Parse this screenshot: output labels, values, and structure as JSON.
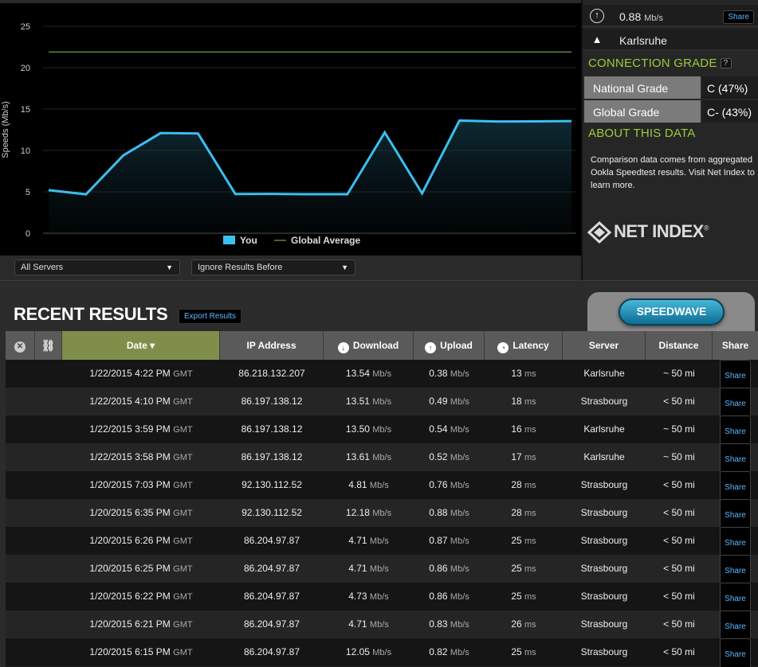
{
  "chart_data": {
    "type": "line",
    "ylabel": "Speeds (Mb/s)",
    "ylim": [
      0,
      25
    ],
    "yticks": [
      "0",
      "5",
      "10",
      "15",
      "20",
      "25"
    ],
    "series": [
      {
        "name": "You",
        "color": "#3bbfef",
        "values": [
          5.2,
          4.7,
          9.4,
          12.1,
          12.05,
          4.73,
          4.75,
          4.71,
          4.71,
          12.18,
          4.81,
          13.61,
          13.5,
          13.51,
          13.54
        ]
      },
      {
        "name": "Global Average",
        "color": "#8ec63f",
        "values": [
          21.9,
          21.9
        ]
      }
    ],
    "grid": true,
    "legend": "bottom-center"
  },
  "filters": {
    "servers": "All Servers",
    "ignore": "Ignore Results Before"
  },
  "side": {
    "upload_value": "0.88",
    "upload_unit": "Mb/s",
    "share": "Share",
    "server": "Karlsruhe",
    "grade_title": "CONNECTION GRADE",
    "help": "?",
    "grades": [
      {
        "label": "National Grade",
        "value": "C (47%)"
      },
      {
        "label": "Global Grade",
        "value": "C- (43%)"
      }
    ],
    "about_title": "ABOUT THIS DATA",
    "about_text": "Comparison data comes from aggregated Ookla Speedtest results. Visit Net Index to learn more.",
    "logo": "NET INDEX",
    "logo_mark": "®"
  },
  "results": {
    "title": "RECENT RESULTS",
    "export": "Export Results",
    "speedwave": "SPEEDWAVE",
    "columns": {
      "date": "Date ▾",
      "ip": "IP Address",
      "download": "Download",
      "upload": "Upload",
      "latency": "Latency",
      "server": "Server",
      "distance": "Distance",
      "share": "Share"
    },
    "rows": [
      {
        "date": "1/22/2015 4:22 PM",
        "tz": "GMT",
        "ip": "86.218.132.207",
        "down": "13.54",
        "up": "0.38",
        "lat": "13",
        "server": "Karlsruhe",
        "dist": "~ 50 mi"
      },
      {
        "date": "1/22/2015 4:10 PM",
        "tz": "GMT",
        "ip": "86.197.138.12",
        "down": "13.51",
        "up": "0.49",
        "lat": "18",
        "server": "Strasbourg",
        "dist": "< 50 mi"
      },
      {
        "date": "1/22/2015 3:59 PM",
        "tz": "GMT",
        "ip": "86.197.138.12",
        "down": "13.50",
        "up": "0.54",
        "lat": "16",
        "server": "Karlsruhe",
        "dist": "~ 50 mi"
      },
      {
        "date": "1/22/2015 3:58 PM",
        "tz": "GMT",
        "ip": "86.197.138.12",
        "down": "13.61",
        "up": "0.52",
        "lat": "17",
        "server": "Karlsruhe",
        "dist": "~ 50 mi"
      },
      {
        "date": "1/20/2015 7:03 PM",
        "tz": "GMT",
        "ip": "92.130.112.52",
        "down": "4.81",
        "up": "0.76",
        "lat": "28",
        "server": "Strasbourg",
        "dist": "< 50 mi"
      },
      {
        "date": "1/20/2015 6:35 PM",
        "tz": "GMT",
        "ip": "92.130.112.52",
        "down": "12.18",
        "up": "0.88",
        "lat": "28",
        "server": "Strasbourg",
        "dist": "< 50 mi"
      },
      {
        "date": "1/20/2015 6:26 PM",
        "tz": "GMT",
        "ip": "86.204.97.87",
        "down": "4.71",
        "up": "0.87",
        "lat": "25",
        "server": "Strasbourg",
        "dist": "< 50 mi"
      },
      {
        "date": "1/20/2015 6:25 PM",
        "tz": "GMT",
        "ip": "86.204.97.87",
        "down": "4.71",
        "up": "0.86",
        "lat": "25",
        "server": "Strasbourg",
        "dist": "< 50 mi"
      },
      {
        "date": "1/20/2015 6:22 PM",
        "tz": "GMT",
        "ip": "86.204.97.87",
        "down": "4.73",
        "up": "0.86",
        "lat": "25",
        "server": "Strasbourg",
        "dist": "< 50 mi"
      },
      {
        "date": "1/20/2015 6:21 PM",
        "tz": "GMT",
        "ip": "86.204.97.87",
        "down": "4.71",
        "up": "0.83",
        "lat": "26",
        "server": "Strasbourg",
        "dist": "< 50 mi"
      },
      {
        "date": "1/20/2015 6:15 PM",
        "tz": "GMT",
        "ip": "86.204.97.87",
        "down": "12.05",
        "up": "0.82",
        "lat": "25",
        "server": "Strasbourg",
        "dist": "< 50 mi"
      }
    ],
    "unit_mbps": "Mb/s",
    "unit_ms": "ms"
  }
}
